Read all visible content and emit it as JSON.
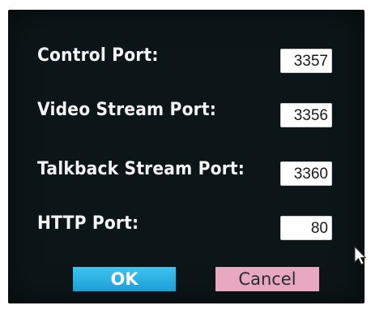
{
  "fields": [
    {
      "label": "Control Port:",
      "value": "3357"
    },
    {
      "label": "Video Stream Port:",
      "value": "3356"
    },
    {
      "label": "Talkback Stream Port:",
      "value": "3360"
    },
    {
      "label": "HTTP Port:",
      "value": "80"
    }
  ],
  "buttons": {
    "ok_label": "OK",
    "cancel_label": "Cancel"
  },
  "colors": {
    "background": "#0c1618",
    "ok_button": "#2bb0e4",
    "cancel_button": "#e8a8c0"
  },
  "icons": {
    "cursor": "mouse-pointer-icon"
  }
}
